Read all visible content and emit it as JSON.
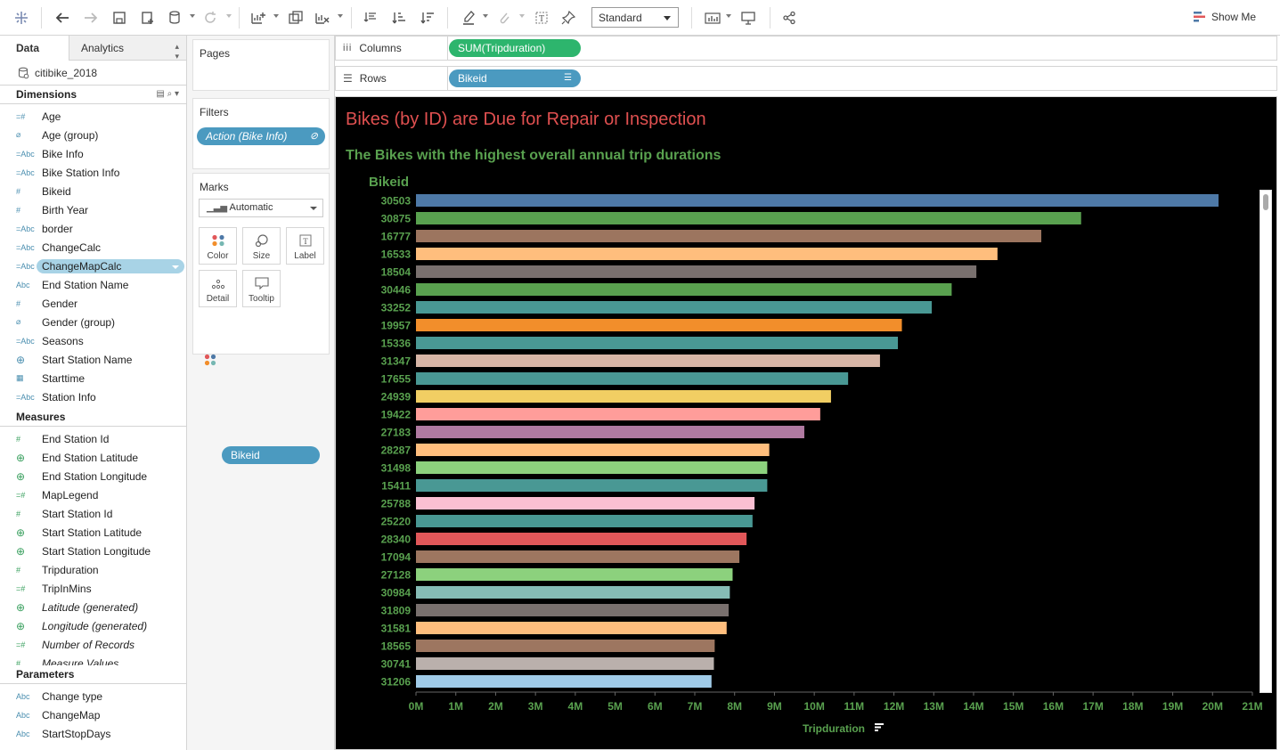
{
  "toolbar": {
    "view_mode": "Standard",
    "show_me": "Show Me"
  },
  "datapane": {
    "tab_data": "Data",
    "tab_analytics": "Analytics",
    "datasource": "citibike_2018",
    "dimensions_header": "Dimensions",
    "dimensions": [
      {
        "icon": "=#",
        "label": "Age",
        "kind": "num"
      },
      {
        "icon": "⌀",
        "label": "Age (group)",
        "kind": "grp"
      },
      {
        "icon": "=Abc",
        "label": "Bike Info",
        "kind": "str"
      },
      {
        "icon": "=Abc",
        "label": "Bike Station Info",
        "kind": "str"
      },
      {
        "icon": "#",
        "label": "Bikeid",
        "kind": "num"
      },
      {
        "icon": "#",
        "label": "Birth Year",
        "kind": "num"
      },
      {
        "icon": "=Abc",
        "label": "border",
        "kind": "str"
      },
      {
        "icon": "=Abc",
        "label": "ChangeCalc",
        "kind": "str"
      },
      {
        "icon": "=Abc",
        "label": "ChangeMapCalc",
        "kind": "str",
        "selected": true
      },
      {
        "icon": "Abc",
        "label": "End Station Name",
        "kind": "str"
      },
      {
        "icon": "#",
        "label": "Gender",
        "kind": "num"
      },
      {
        "icon": "⌀",
        "label": "Gender (group)",
        "kind": "grp"
      },
      {
        "icon": "=Abc",
        "label": "Seasons",
        "kind": "str"
      },
      {
        "icon": "⊕",
        "label": "Start Station Name",
        "kind": "geo"
      },
      {
        "icon": "▦",
        "label": "Starttime",
        "kind": "date"
      },
      {
        "icon": "=Abc",
        "label": "Station Info",
        "kind": "str"
      }
    ],
    "measures_header": "Measures",
    "measures": [
      {
        "icon": "#",
        "label": "End Station Id",
        "kind": "meas"
      },
      {
        "icon": "⊕",
        "label": "End Station Latitude",
        "kind": "geo"
      },
      {
        "icon": "⊕",
        "label": "End Station Longitude",
        "kind": "geo"
      },
      {
        "icon": "=#",
        "label": "MapLegend",
        "kind": "meas"
      },
      {
        "icon": "#",
        "label": "Start Station Id",
        "kind": "meas"
      },
      {
        "icon": "⊕",
        "label": "Start Station Latitude",
        "kind": "geo"
      },
      {
        "icon": "⊕",
        "label": "Start Station Longitude",
        "kind": "geo"
      },
      {
        "icon": "#",
        "label": "Tripduration",
        "kind": "meas"
      },
      {
        "icon": "=#",
        "label": "TripInMins",
        "kind": "meas"
      },
      {
        "icon": "⊕",
        "label": "Latitude (generated)",
        "kind": "geo",
        "italic": true
      },
      {
        "icon": "⊕",
        "label": "Longitude (generated)",
        "kind": "geo",
        "italic": true
      },
      {
        "icon": "=#",
        "label": "Number of Records",
        "kind": "meas",
        "italic": true
      },
      {
        "icon": "#",
        "label": "Measure Values",
        "kind": "meas",
        "italic": true
      }
    ],
    "parameters_header": "Parameters",
    "parameters": [
      {
        "icon": "Abc",
        "label": "Change type"
      },
      {
        "icon": "Abc",
        "label": "ChangeMap"
      },
      {
        "icon": "Abc",
        "label": "StartStopDays"
      }
    ]
  },
  "cards": {
    "pages_title": "Pages",
    "filters_title": "Filters",
    "filter_pill": "Action (Bike Info)",
    "marks_title": "Marks",
    "marks_type": "Automatic",
    "mark_buttons": [
      "Color",
      "Size",
      "Label",
      "Detail",
      "Tooltip"
    ],
    "marks_pill": "Bikeid"
  },
  "shelves": {
    "columns_label": "Columns",
    "columns_pill": "SUM(Tripduration)",
    "rows_label": "Rows",
    "rows_pill": "Bikeid"
  },
  "viz": {
    "title": "Bikes (by ID) are Due for Repair or Inspection",
    "subtitle": "The Bikes with the highest overall annual trip durations"
  },
  "colors": {
    "title": "#e05050",
    "subtitle": "#59a14f",
    "pill_green": "#2db56d",
    "pill_blue": "#4b9ac0",
    "axis_text": "#59a14f"
  },
  "chart_data": {
    "type": "bar",
    "orientation": "horizontal",
    "ylabel": "Bikeid",
    "xlabel": "Tripduration",
    "xlim": [
      0,
      21000000
    ],
    "xticks": [
      "0M",
      "1M",
      "2M",
      "3M",
      "4M",
      "5M",
      "6M",
      "7M",
      "8M",
      "9M",
      "10M",
      "11M",
      "12M",
      "13M",
      "14M",
      "15M",
      "16M",
      "17M",
      "18M",
      "19M",
      "20M",
      "21M"
    ],
    "categories": [
      "30503",
      "30875",
      "16777",
      "16533",
      "18504",
      "30446",
      "33252",
      "19957",
      "15336",
      "31347",
      "17655",
      "24939",
      "19422",
      "27183",
      "28287",
      "31498",
      "15411",
      "25788",
      "25220",
      "28340",
      "17094",
      "27128",
      "30984",
      "31809",
      "31581",
      "18565",
      "30741",
      "31206"
    ],
    "values": [
      20150000,
      16700000,
      15700000,
      14600000,
      14070000,
      13450000,
      12950000,
      12200000,
      12100000,
      11650000,
      10850000,
      10420000,
      10150000,
      9750000,
      8870000,
      8820000,
      8820000,
      8500000,
      8450000,
      8300000,
      8120000,
      7950000,
      7880000,
      7850000,
      7800000,
      7500000,
      7480000,
      7420000
    ],
    "bar_colors": [
      "#4e79a7",
      "#59a14f",
      "#9c755f",
      "#ffbe7d",
      "#79706e",
      "#59a14f",
      "#499894",
      "#f28e2b",
      "#499894",
      "#d7b5a6",
      "#499894",
      "#f1ce63",
      "#ff9d9a",
      "#b07aa1",
      "#ffbe7d",
      "#8cd17d",
      "#499894",
      "#fabfd2",
      "#499894",
      "#e15759",
      "#9d7660",
      "#8cd17d",
      "#86bcb6",
      "#79706e",
      "#ffbe7d",
      "#9d7660",
      "#bab0ac",
      "#a0cbe8"
    ]
  }
}
